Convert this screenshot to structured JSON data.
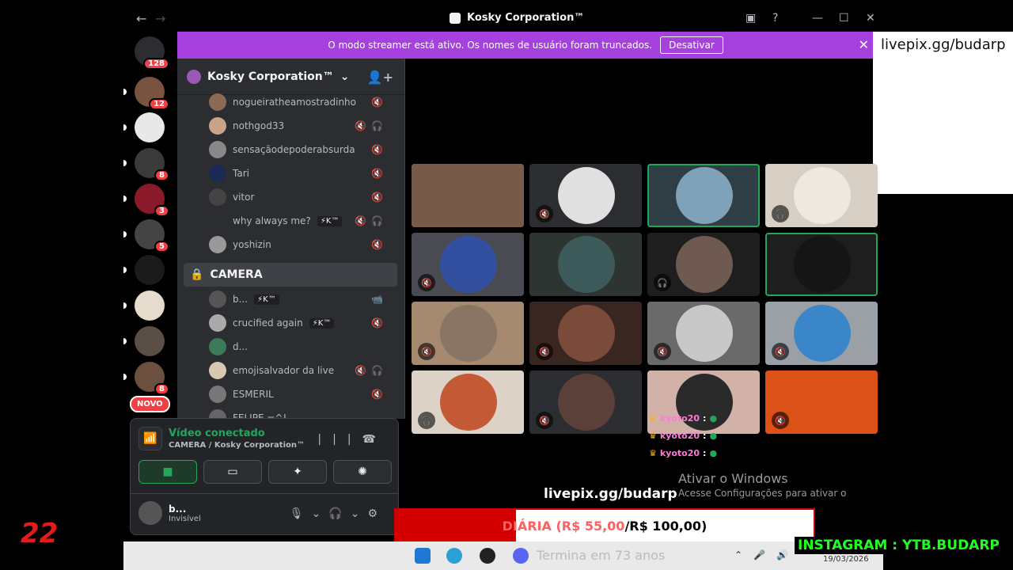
{
  "window": {
    "title": "Kosky Corporation™"
  },
  "servers": [
    {
      "badge": "128",
      "color": "#2b2d31",
      "pip": false
    },
    {
      "badge": "12",
      "color": "#7a5240",
      "pip": true
    },
    {
      "badge": "",
      "color": "#e8e8e8",
      "pip": true
    },
    {
      "badge": "8",
      "color": "#3a3a3a",
      "pip": true
    },
    {
      "badge": "3",
      "color": "#8a1a2a",
      "pip": true
    },
    {
      "badge": "5",
      "color": "#444444",
      "pip": true
    },
    {
      "badge": "",
      "color": "#1b1b1b",
      "pip": true
    },
    {
      "badge": "",
      "color": "#e6dccd",
      "pip": true
    },
    {
      "badge": "",
      "color": "#5a4e46",
      "pip": true
    },
    {
      "badge": "8",
      "color": "#6b5040",
      "pip": true
    }
  ],
  "novo_label": "NOVO",
  "banner": {
    "text": "O modo streamer está ativo. Os nomes de usuário foram truncados.",
    "button": "Desativar"
  },
  "overlay_text": "livepix.gg/budarp",
  "guild": {
    "name": "Kosky Corporation™"
  },
  "members_top": [
    {
      "name": "nogueiratheamostradinho",
      "tag": "",
      "icons": "🔇",
      "color": "#8a6a55"
    },
    {
      "name": "nothgod33",
      "tag": "",
      "icons": "🔇🎧",
      "color": "#c9a38a"
    },
    {
      "name": "sensaçãodepoderabsurda",
      "tag": "",
      "icons": "🔇",
      "color": "#888"
    },
    {
      "name": "Tari",
      "tag": "",
      "icons": "🔇",
      "color": "#1a2a55"
    },
    {
      "name": "vitor",
      "tag": "",
      "icons": "🔇",
      "color": "#444"
    },
    {
      "name": "why always me?",
      "tag": "⚡K™",
      "icons": "🔇🎧",
      "color": "#2b2d31"
    },
    {
      "name": "yoshizin",
      "tag": "",
      "icons": "🔇",
      "color": "#999"
    }
  ],
  "channel": {
    "name": "CAMERA"
  },
  "members_cam": [
    {
      "name": "b...",
      "tag": "⚡K™",
      "icons": "📹",
      "color": "#555"
    },
    {
      "name": "crucified again",
      "tag": "⚡K™",
      "icons": "🔇",
      "color": "#aaa"
    },
    {
      "name": "d...",
      "tag": "",
      "icons": "",
      "color": "#3c7a5a"
    },
    {
      "name": "emojisalvador da live",
      "tag": "",
      "icons": "🔇🎧",
      "color": "#d9c8b0"
    },
    {
      "name": "ESMERIL",
      "tag": "",
      "icons": "🔇",
      "color": "#777"
    },
    {
      "name": "FELIPE =^!",
      "tag": "",
      "icons": "",
      "color": "#666"
    }
  ],
  "voice": {
    "status": "Vídeo conectado",
    "location": "CAMERA / Kosky Corporation™",
    "user": "b...",
    "user_status": "Invisível"
  },
  "tiles": [
    {
      "bg": "#b8b8b0",
      "circ": "#6a4a3a",
      "mute": "",
      "speaking": false,
      "full": true
    },
    {
      "bg": "#2b2d31",
      "circ": "#e0e0e0",
      "mute": "🔇",
      "speaking": false,
      "full": false
    },
    {
      "bg": "#2f3d45",
      "circ": "#7fa2b8",
      "mute": "",
      "speaking": true,
      "full": false
    },
    {
      "bg": "#d8cfc4",
      "circ": "#efe8de",
      "mute": "🎧",
      "speaking": false,
      "full": false
    },
    {
      "bg": "#4a4a52",
      "circ": "#3350a0",
      "mute": "🔇",
      "speaking": false,
      "full": false
    },
    {
      "bg": "#2e3432",
      "circ": "#3d5a5a",
      "mute": "",
      "speaking": false,
      "full": false
    },
    {
      "bg": "#1e1e1e",
      "circ": "#6e5a50",
      "mute": "🎧",
      "speaking": false,
      "full": false
    },
    {
      "bg": "#1e1e1e",
      "circ": "#151515",
      "mute": "",
      "speaking": true,
      "full": false
    },
    {
      "bg": "#a58a70",
      "circ": "#8a7565",
      "mute": "🔇",
      "speaking": false,
      "full": false
    },
    {
      "bg": "#3a2620",
      "circ": "#7a4a3a",
      "mute": "🔇",
      "speaking": false,
      "full": false
    },
    {
      "bg": "#6a6a6a",
      "circ": "#c8c8c8",
      "mute": "🔇",
      "speaking": false,
      "full": false
    },
    {
      "bg": "#9aa0a6",
      "circ": "#3a86c9",
      "mute": "🔇",
      "speaking": false,
      "full": false
    },
    {
      "bg": "#dcd2c8",
      "circ": "#c45a35",
      "mute": "🎧",
      "speaking": false,
      "full": false
    },
    {
      "bg": "#2b2d31",
      "circ": "#5a4038",
      "mute": "🔇",
      "speaking": false,
      "full": false
    },
    {
      "bg": "#d2b2a8",
      "circ": "#2a2a2a",
      "mute": "",
      "speaking": false,
      "full": false
    },
    {
      "bg": "#b84020",
      "circ": "#e05518",
      "mute": "🔇",
      "speaking": false,
      "full": true
    }
  ],
  "chat": [
    {
      "user": "kyoto20"
    },
    {
      "user": "kyoto20"
    },
    {
      "user": "kyoto20"
    }
  ],
  "livepix_label": "livepix.gg/budarp",
  "windows_activation": {
    "heading": "Ativar o Windows",
    "sub": "Acesse Configurações para ativar o"
  },
  "goal": {
    "current": "DIÁRIA (R$ 55,00",
    "target": "/R$ 100,00)",
    "progress": 0.55
  },
  "counter": "22",
  "taskbar": {
    "ticker": "Termina em 73 anos",
    "date": "19/03/2026"
  },
  "instagram": "INSTAGRAM : YTB.BUDARP"
}
